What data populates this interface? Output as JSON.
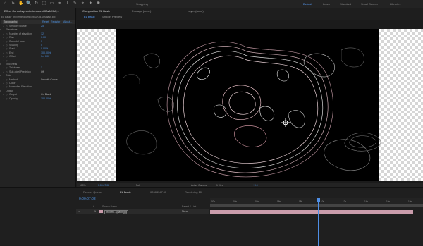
{
  "toolbar": {
    "tools": [
      "⌂",
      "➤",
      "✋",
      "🔍",
      "↻",
      "⬚",
      "▭",
      "✒",
      "T",
      "✎",
      "⌖",
      "✦",
      "✺"
    ],
    "snapping": "Snapping",
    "workspaces": [
      "Default",
      "Learn",
      "Standard",
      "Small Screen",
      "Libraries"
    ]
  },
  "effect_controls": {
    "tab": "Effect Controls proximite-doumi-f2w6JKMj…",
    "layer": "EL Basic · proximite-doumi-f2w6JKMj-unsplash.jpg",
    "effect": {
      "name": "Topographic",
      "reset": "Reset",
      "register": "Register",
      "about": "About..."
    },
    "rows": [
      {
        "label": "Smooth Source",
        "value": "25",
        "indent": 1
      },
      {
        "label": "Elevations",
        "value": "",
        "indent": 0,
        "twirl": "▾"
      },
      {
        "label": "Number of elevation",
        "value": "12",
        "indent": 1
      },
      {
        "label": "Rise",
        "value": "0.00",
        "indent": 1
      },
      {
        "label": "Smooth Lines",
        "value": "0",
        "indent": 1
      },
      {
        "label": "Spacing",
        "value": "0",
        "indent": 1
      },
      {
        "label": "Start",
        "value": "0.00%",
        "indent": 1
      },
      {
        "label": "End",
        "value": "100.00%",
        "indent": 1
      },
      {
        "label": "Offset",
        "value": "0x+0.0°",
        "indent": 1
      },
      {
        "label": "",
        "value": "",
        "indent": 1
      },
      {
        "label": "Thickness",
        "value": "",
        "indent": 0,
        "twirl": "▾"
      },
      {
        "label": "Thickness",
        "value": "1",
        "indent": 1
      },
      {
        "label": "Sub-pixel Precision",
        "value": "Off",
        "indent": 1
      },
      {
        "label": "Color",
        "value": "",
        "indent": 0,
        "twirl": "▾"
      },
      {
        "label": "Method",
        "value": "Smooth Colors",
        "indent": 1
      },
      {
        "label": "Color",
        "value": "",
        "indent": 1
      },
      {
        "label": "Normalize Elevation",
        "value": "",
        "indent": 1
      },
      {
        "label": "Output",
        "value": "",
        "indent": 0,
        "twirl": "▾"
      },
      {
        "label": "Output",
        "value": "On Black",
        "indent": 1
      },
      {
        "label": "Opacity",
        "value": "100.00%",
        "indent": 1
      }
    ]
  },
  "composition": {
    "tabs": [
      "Composition EL Basic",
      "Footage (none)",
      "Layer (none)"
    ],
    "sub_tabs": [
      "EL Basic",
      "Smooth Preview"
    ],
    "viewer_bar": {
      "zoom": "100%",
      "time": "0:00:07:08",
      "resolution": "Full",
      "camera": "Active Camera",
      "views": "1 View",
      "extra": "+0.0"
    }
  },
  "timeline": {
    "tabs": [
      "Render Queue",
      "EL Basic",
      "02084347.tif",
      "Rendering 10"
    ],
    "timecode": "0:00:07:08",
    "columns": [
      "#",
      "Source Name",
      "Parent & Link"
    ],
    "layer": {
      "index": "1",
      "name": "proxim...splash.jpg",
      "parent": "None"
    },
    "ruler_ticks": [
      "00s",
      "02s",
      "04s",
      "06s",
      "08s",
      "10s",
      "12s",
      "14s",
      "16s",
      "18s"
    ]
  },
  "colors": {
    "accent": "#4f8fe6",
    "value_blue": "#4d8fdc",
    "layer_bar": "#c99cab"
  }
}
